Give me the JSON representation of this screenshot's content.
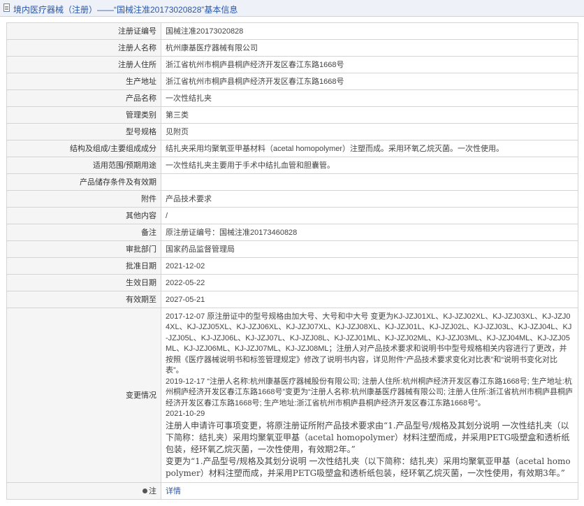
{
  "header": {
    "title": "境内医疗器械（注册）——“国械注准20173020828”基本信息"
  },
  "rows": [
    {
      "label": "注册证编号",
      "value": "国械注准20173020828"
    },
    {
      "label": "注册人名称",
      "value": "杭州康基医疗器械有限公司"
    },
    {
      "label": "注册人住所",
      "value": "浙江省杭州市桐庐县桐庐经济开发区春江东路1668号"
    },
    {
      "label": "生产地址",
      "value": "浙江省杭州市桐庐县桐庐经济开发区春江东路1668号"
    },
    {
      "label": "产品名称",
      "value": "一次性结扎夹"
    },
    {
      "label": "管理类别",
      "value": "第三类"
    },
    {
      "label": "型号规格",
      "value": "见附页"
    },
    {
      "label": "结构及组成/主要组成成分",
      "value": "结扎夹采用均聚氧亚甲基材料（acetal homopolymer）注塑而成。采用环氧乙烷灭菌。一次性使用。"
    },
    {
      "label": "适用范围/预期用途",
      "value": "一次性结扎夹主要用于手术中结扎血管和胆囊管。"
    },
    {
      "label": "产品储存条件及有效期",
      "value": ""
    },
    {
      "label": "附件",
      "value": "产品技术要求"
    },
    {
      "label": "其他内容",
      "value": "/"
    },
    {
      "label": "备注",
      "value": "原注册证编号：国械注准20173460828"
    },
    {
      "label": "审批部门",
      "value": "国家药品监督管理局"
    },
    {
      "label": "批准日期",
      "value": "2021-12-02"
    },
    {
      "label": "生效日期",
      "value": "2022-05-22"
    },
    {
      "label": "有效期至",
      "value": "2027-05-21"
    }
  ],
  "change": {
    "label": "变更情况",
    "p1": "2017-12-07 原注册证中的型号规格由加大号、大号和中大号 变更为KJ-JZJ01XL、KJ-JZJ02XL、KJ-JZJ03XL、KJ-JZJ04XL、KJ-JZJ05XL、KJ-JZJ06XL、KJ-JZJ07XL、KJ-JZJ08XL、KJ-JZJ01L、KJ-JZJ02L、KJ-JZJ03L、KJ-JZJ04L、KJ-JZJ05L、KJ-JZJ06L、KJ-JZJ07L、KJ-JZJ08L、KJ-JZJ01ML、KJ-JZJ02ML、KJ-JZJ03ML、KJ-JZJ04ML、KJ-JZJ05ML、KJ-JZJ06ML、KJ-JZJ07ML、KJ-JZJ08ML；注册人对产品技术要求和说明书中型号规格相关内容进行了更改，并按照《医疗器械说明书和标签管理规定》修改了说明书内容，详见附件“产品技术要求变化对比表”和“说明书变化对比表”。",
    "p2": "2019-12-17 “注册人名称:杭州康基医疗器械股份有限公司; 注册人住所:杭州桐庐经济开发区春江东路1668号; 生产地址:杭州桐庐经济开发区春江东路1668号”变更为“注册人名称:杭州康基医疗器械有限公司; 注册人住所:浙江省杭州市桐庐县桐庐经济开发区春江东路1668号; 生产地址:浙江省杭州市桐庐县桐庐经济开发区春江东路1668号”。",
    "p3": "2021-10-29",
    "p4": "注册人申请许可事项变更，将原注册证所附产品技术要求由“1.产品型号/规格及其划分说明 一次性结扎夹（以下简称：结扎夹）采用均聚氧亚甲基（acetal homopolymer）材料注塑而成，并采用PETG吸塑盒和透析纸包装，经环氧乙烷灭菌，一次性使用，有效期2年。”",
    "p5": "变更为“1.产品型号/规格及其划分说明 一次性结扎夹（以下简称：结扎夹）采用均聚氧亚甲基（acetal homopolymer）材料注塑而成，并采用PETG吸塑盒和透析纸包装，经环氧乙烷灭菌，一次性使用，有效期3年。”"
  },
  "note": {
    "label": "注",
    "value": "详情"
  }
}
